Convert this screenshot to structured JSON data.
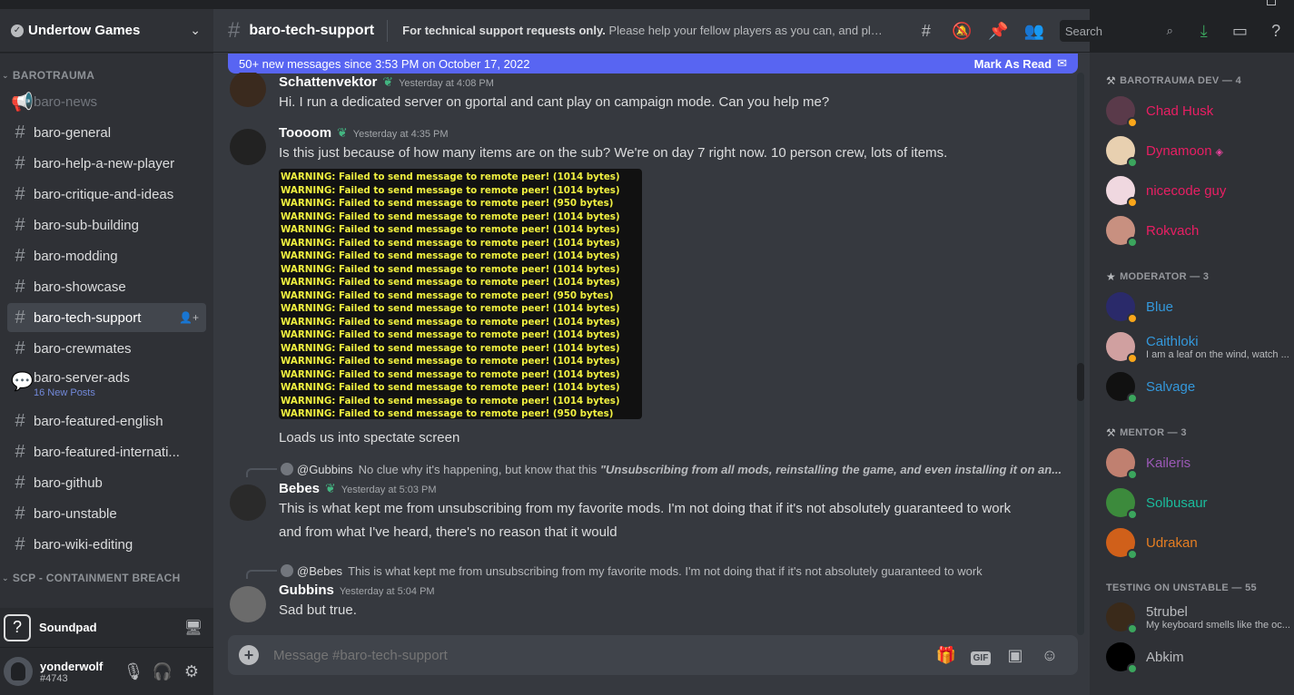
{
  "guild": {
    "name": "Undertow Games"
  },
  "sidebar": {
    "categories": [
      {
        "label": "BAROTRAUMA"
      },
      {
        "label": "SCP - CONTAINMENT BREACH"
      }
    ],
    "channels": [
      {
        "label": "baro-news",
        "icon": "megaphone-icon"
      },
      {
        "label": "baro-general",
        "icon": "hash-icon"
      },
      {
        "label": "baro-help-a-new-player",
        "icon": "hash-icon"
      },
      {
        "label": "baro-critique-and-ideas",
        "icon": "thread-hash-icon"
      },
      {
        "label": "baro-sub-building",
        "icon": "thread-hash-icon"
      },
      {
        "label": "baro-modding",
        "icon": "hash-icon"
      },
      {
        "label": "baro-showcase",
        "icon": "hash-icon"
      },
      {
        "label": "baro-tech-support",
        "icon": "hash-icon"
      },
      {
        "label": "baro-crewmates",
        "icon": "hash-icon"
      },
      {
        "label": "baro-server-ads",
        "sub": "16 New Posts",
        "icon": "forum-icon"
      },
      {
        "label": "baro-featured-english",
        "icon": "hash-icon"
      },
      {
        "label": "baro-featured-internati...",
        "icon": "thread-hash-icon"
      },
      {
        "label": "baro-github",
        "icon": "hash-icon"
      },
      {
        "label": "baro-unstable",
        "icon": "hash-icon"
      },
      {
        "label": "baro-wiki-editing",
        "icon": "thread-hash-icon"
      }
    ]
  },
  "soundpad": {
    "label": "Soundpad"
  },
  "user": {
    "name": "yonderwolf",
    "tag": "#4743"
  },
  "channel_header": {
    "name": "baro-tech-support",
    "topic_bold": "For technical support requests only.",
    "topic_rest": " Please help your fellow players as you can, and plea..."
  },
  "toolbar": {
    "search_placeholder": "Search"
  },
  "new_messages_bar": {
    "text": "50+ new messages since 3:53 PM on October 17, 2022",
    "mark_read": "Mark As Read"
  },
  "messages": [
    {
      "author": "Schattenvektor",
      "timestamp": "Yesterday at 4:08 PM",
      "text": "Hi. I run a dedicated server on gportal and cant play on campaign mode. Can you help me?"
    },
    {
      "author": "Toooom",
      "timestamp": "Yesterday at 4:35 PM",
      "text": "Is this just because of how many items are on the sub? We're on day 7 right now. 10 person crew, lots of items.",
      "image_lines": [
        "WARNING: Failed to send message to remote peer! (1014 bytes)",
        "WARNING: Failed to send message to remote peer! (1014 bytes)",
        "WARNING: Failed to send message to remote peer! (950 bytes)",
        "WARNING: Failed to send message to remote peer! (1014 bytes)",
        "WARNING: Failed to send message to remote peer! (1014 bytes)",
        "WARNING: Failed to send message to remote peer! (1014 bytes)",
        "WARNING: Failed to send message to remote peer! (1014 bytes)",
        "WARNING: Failed to send message to remote peer! (1014 bytes)",
        "WARNING: Failed to send message to remote peer! (1014 bytes)",
        "WARNING: Failed to send message to remote peer! (950 bytes)",
        "WARNING: Failed to send message to remote peer! (1014 bytes)",
        "WARNING: Failed to send message to remote peer! (1014 bytes)",
        "WARNING: Failed to send message to remote peer! (1014 bytes)",
        "WARNING: Failed to send message to remote peer! (1014 bytes)",
        "WARNING: Failed to send message to remote peer! (1014 bytes)",
        "WARNING: Failed to send message to remote peer! (1014 bytes)",
        "WARNING: Failed to send message to remote peer! (1014 bytes)",
        "WARNING: Failed to send message to remote peer! (1014 bytes)",
        "WARNING: Failed to send message to remote peer! (950 bytes)"
      ],
      "followup": "Loads us into spectate screen"
    },
    {
      "reply_user": "@Gubbins",
      "reply_text": "No clue why it's happening, but know that this ",
      "reply_quote": "\"Unsubscribing from all mods, reinstalling the game, and even installing it on an...",
      "author": "Bebes",
      "timestamp": "Yesterday at 5:03 PM",
      "text": "This is what kept me from unsubscribing from my favorite mods. I'm not doing that if it's not absolutely guaranteed to work and from what I've heard, there's no reason that it would"
    },
    {
      "reply_user": "@Bebes",
      "reply_text": "This is what kept me from unsubscribing from my favorite mods. I'm not doing that if it's not absolutely guaranteed to work",
      "author": "Gubbins",
      "timestamp": "Yesterday at 5:04 PM",
      "text": "Sad but true."
    }
  ],
  "composer": {
    "placeholder": "Message #baro-tech-support"
  },
  "members": {
    "groups": [
      {
        "label": "BAROTRAUMA DEV — 4",
        "members": [
          {
            "name": "Chad Husk",
            "color": "#e91e63",
            "status": "idle"
          },
          {
            "name": "Dynamoon",
            "color": "#e91e63",
            "status": "online",
            "badge": "nitro-gem-icon"
          },
          {
            "name": "nicecode guy",
            "color": "#e91e63",
            "status": "idle"
          },
          {
            "name": "Rokvach",
            "color": "#e91e63",
            "status": "online"
          }
        ]
      },
      {
        "label": "MODERATOR — 3",
        "members": [
          {
            "name": "Blue",
            "color": "#3498db",
            "status": "idle"
          },
          {
            "name": "Caithloki",
            "color": "#3498db",
            "status": "idle",
            "status_text": "I am a leaf on the wind, watch ..."
          },
          {
            "name": "Salvage",
            "color": "#3498db",
            "status": "online"
          }
        ]
      },
      {
        "label": "MENTOR — 3",
        "members": [
          {
            "name": "Kaileris",
            "color": "#9b59b6",
            "status": "online"
          },
          {
            "name": "Solbusaur",
            "color": "#1abc9c",
            "status": "online"
          },
          {
            "name": "Udrakan",
            "color": "#e67e22",
            "status": "online"
          }
        ]
      },
      {
        "label": "TESTING ON UNSTABLE — 55",
        "members": [
          {
            "name": "5trubel",
            "color": "#b9bbbe",
            "status": "online",
            "status_text": "My keyboard smells like the oc..."
          },
          {
            "name": "Abkim",
            "color": "#b9bbbe",
            "status": "online"
          }
        ]
      }
    ]
  },
  "colors": {
    "accent": "#5865f2",
    "online": "#3ba55d",
    "idle": "#faa61a"
  }
}
